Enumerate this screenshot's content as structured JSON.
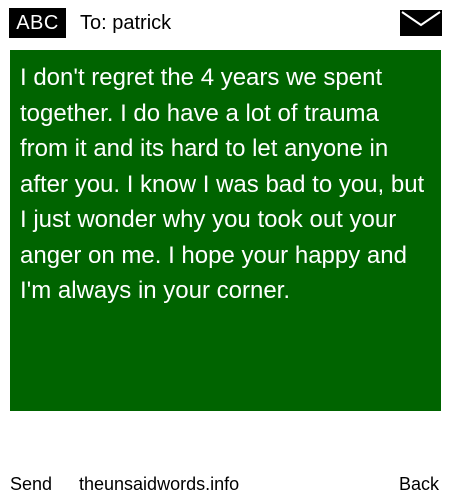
{
  "header": {
    "input_mode": "ABC",
    "recipient": "To: patrick",
    "icon": "envelope-icon"
  },
  "message": {
    "text": "I don't regret the 4 years we spent together. I do have a lot of trauma from it and its hard to let anyone in after you. I know I was bad to you, but I just wonder why you took out your anger on me. I hope your happy and I'm always in your corner.",
    "background_color": "#006400",
    "text_color": "#ffffff"
  },
  "footer": {
    "send_label": "Send",
    "site_label": "theunsaidwords.info",
    "back_label": "Back"
  }
}
